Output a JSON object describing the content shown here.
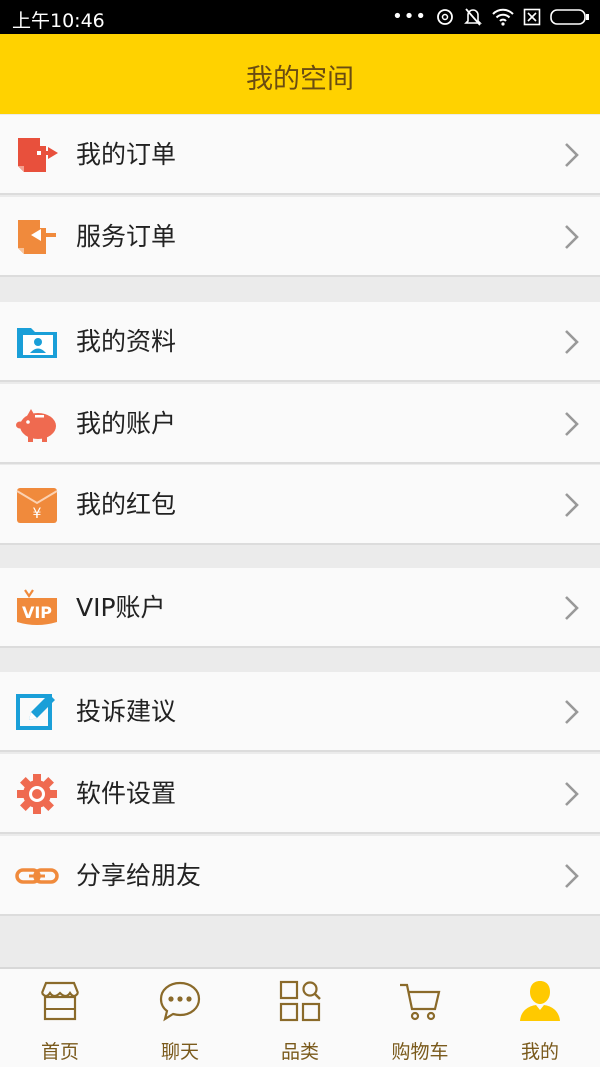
{
  "status_bar": {
    "time": "上午10:46"
  },
  "header": {
    "title": "我的空间"
  },
  "menu": [
    {
      "label": "我的订单"
    },
    {
      "label": "服务订单"
    },
    {
      "label": "我的资料"
    },
    {
      "label": "我的账户"
    },
    {
      "label": "我的红包"
    },
    {
      "label": "VIP账户"
    },
    {
      "label": "投诉建议"
    },
    {
      "label": "软件设置"
    },
    {
      "label": "分享给朋友"
    }
  ],
  "tabbar": {
    "items": [
      {
        "label": "首页"
      },
      {
        "label": "聊天"
      },
      {
        "label": "品类"
      },
      {
        "label": "购物车"
      },
      {
        "label": "我的"
      }
    ]
  },
  "colors": {
    "header": "#ffd200",
    "accent_text": "#7a5a1c",
    "active_tab": "#ffc900"
  }
}
